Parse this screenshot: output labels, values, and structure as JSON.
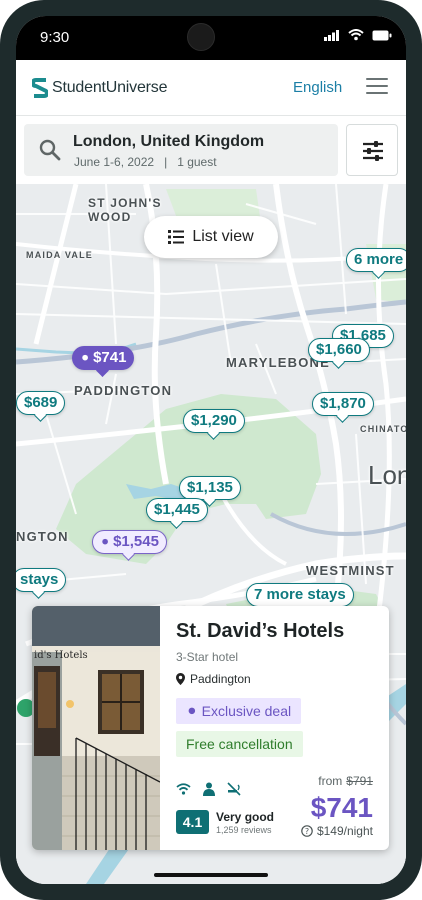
{
  "status_bar": {
    "time": "9:30"
  },
  "app": {
    "brand": "StudentUniverse",
    "language": "English"
  },
  "search": {
    "destination": "London, United Kingdom",
    "dates": "June 1-6, 2022",
    "guests": "1 guest"
  },
  "map": {
    "list_view_label": "List view",
    "area_labels": [
      "ST JOHN'S WOOD",
      "MAIDA VALE",
      "PADDINGTON",
      "MARYLEBONE",
      "CHINATO",
      "Lon",
      "NGTON",
      "WESTMINST"
    ],
    "pins": [
      {
        "label": "6 more",
        "kind": "cluster"
      },
      {
        "label": "$1,685",
        "kind": "price"
      },
      {
        "label": "$1,660",
        "kind": "price"
      },
      {
        "label": "$741",
        "kind": "deal-selected"
      },
      {
        "label": "$689",
        "kind": "price"
      },
      {
        "label": "$1,290",
        "kind": "price"
      },
      {
        "label": "$1,870",
        "kind": "price"
      },
      {
        "label": "$1,135",
        "kind": "price"
      },
      {
        "label": "$1,445",
        "kind": "price"
      },
      {
        "label": "$1,545",
        "kind": "deal"
      },
      {
        "label": "stays",
        "kind": "cluster"
      },
      {
        "label": "7 more stays",
        "kind": "cluster"
      }
    ]
  },
  "hotel": {
    "name": "St. David’s Hotels",
    "class": "3-Star hotel",
    "location": "Paddington",
    "deal_badge": "Exclusive deal",
    "cancellation_badge": "Free cancellation",
    "amenities": [
      "wifi-icon",
      "concierge-icon",
      "no-smoking-icon"
    ],
    "rating": "4.1",
    "rating_text": "Very good",
    "review_count": "1,259 reviews",
    "price_from_label": "from",
    "price_original": "$791",
    "price": "$741",
    "price_per_night": "$149/night",
    "photo_sign": "id's Hotels"
  },
  "colors": {
    "teal": "#0f7a7f",
    "deal_purple": "#6b55c2",
    "link_blue": "#1c7fa6",
    "phone_frame": "#1e2b2c"
  }
}
